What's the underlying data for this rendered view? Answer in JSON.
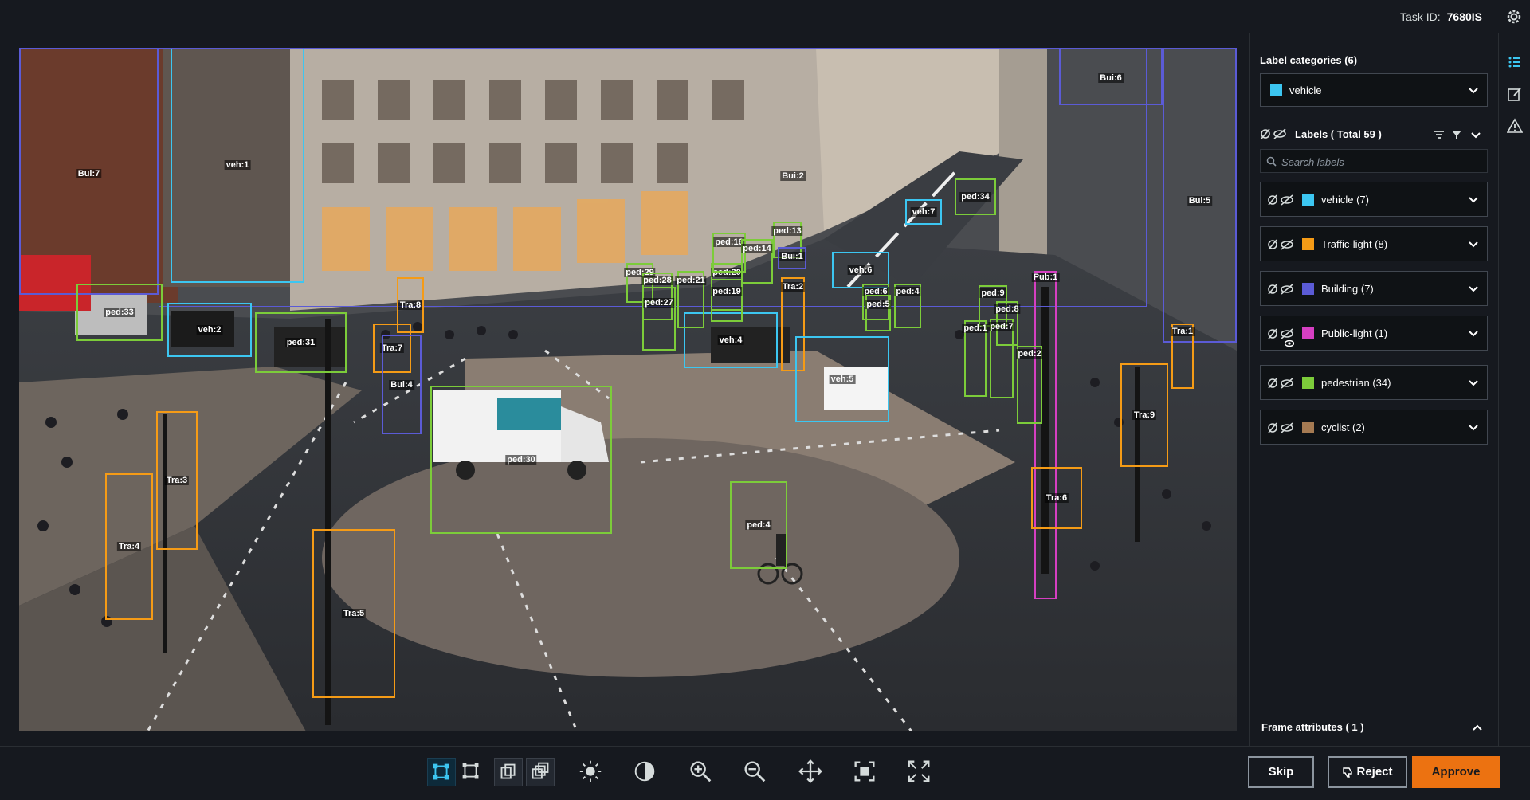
{
  "header": {
    "task_label": "Task ID:",
    "task_id": "7680IS"
  },
  "panel": {
    "categories_title": "Label categories (6)",
    "selected_category": {
      "label": "vehicle",
      "color": "#3cc6f1"
    },
    "labels_title": "Labels ( Total 59 )",
    "search_placeholder": "Search labels",
    "label_groups": [
      {
        "label": "vehicle (7)",
        "color": "#3cc6f1"
      },
      {
        "label": "Traffic-light (8)",
        "color": "#f59b16"
      },
      {
        "label": "Building (7)",
        "color": "#5b5bd6"
      },
      {
        "label": "Public-light (1)",
        "color": "#d63fc2"
      },
      {
        "label": "pedestrian (34)",
        "color": "#7ccc3a"
      },
      {
        "label": "cyclist (2)",
        "color": "#a57a52"
      }
    ],
    "frame_attributes": "Frame attributes ( 1 )"
  },
  "footer": {
    "skip": "Skip",
    "reject": "Reject",
    "approve": "Approve"
  },
  "annotations": [
    {
      "tag": "Bui:7",
      "color": "#5b5bd6"
    },
    {
      "tag": "veh:1",
      "color": "#3cc6f1"
    },
    {
      "tag": "Bui:2",
      "color": "#5b5bd6"
    },
    {
      "tag": "Bui:6",
      "color": "#5b5bd6"
    },
    {
      "tag": "Bui:5",
      "color": "#5b5bd6"
    },
    {
      "tag": "ped:33",
      "color": "#7ccc3a"
    },
    {
      "tag": "veh:2",
      "color": "#3cc6f1"
    },
    {
      "tag": "ped:31",
      "color": "#7ccc3a"
    },
    {
      "tag": "Tra:8",
      "color": "#f59b16"
    },
    {
      "tag": "Tra:7",
      "color": "#f59b16"
    },
    {
      "tag": "Bui:4",
      "color": "#5b5bd6"
    },
    {
      "tag": "ped:30",
      "color": "#7ccc3a"
    },
    {
      "tag": "veh:4",
      "color": "#3cc6f1"
    },
    {
      "tag": "Tra:2",
      "color": "#f59b16"
    },
    {
      "tag": "veh:5",
      "color": "#3cc6f1"
    },
    {
      "tag": "veh:6",
      "color": "#3cc6f1"
    },
    {
      "tag": "veh:7",
      "color": "#3cc6f1"
    },
    {
      "tag": "ped:34",
      "color": "#7ccc3a"
    },
    {
      "tag": "Pub:1",
      "color": "#d63fc2"
    },
    {
      "tag": "Tra:1",
      "color": "#f59b16"
    },
    {
      "tag": "Tra:9",
      "color": "#f59b16"
    },
    {
      "tag": "Tra:6",
      "color": "#f59b16"
    },
    {
      "tag": "Tra:3",
      "color": "#f59b16"
    },
    {
      "tag": "Tra:4",
      "color": "#f59b16"
    },
    {
      "tag": "Tra:5",
      "color": "#f59b16"
    },
    {
      "tag": "ped:4",
      "color": "#7ccc3a"
    },
    {
      "tag": "ped:29",
      "color": "#7ccc3a"
    },
    {
      "tag": "ped:28",
      "color": "#7ccc3a"
    },
    {
      "tag": "ped:27",
      "color": "#7ccc3a"
    },
    {
      "tag": "ped:21",
      "color": "#7ccc3a"
    },
    {
      "tag": "ped:20",
      "color": "#7ccc3a"
    },
    {
      "tag": "ped:19",
      "color": "#7ccc3a"
    },
    {
      "tag": "ped:16",
      "color": "#7ccc3a"
    },
    {
      "tag": "ped:14",
      "color": "#7ccc3a"
    },
    {
      "tag": "ped:13",
      "color": "#7ccc3a"
    },
    {
      "tag": "Bui:1",
      "color": "#5b5bd6"
    },
    {
      "tag": "ped:6",
      "color": "#7ccc3a"
    },
    {
      "tag": "ped:5",
      "color": "#7ccc3a"
    },
    {
      "tag": "ped:4",
      "color": "#7ccc3a"
    },
    {
      "tag": "ped:9",
      "color": "#7ccc3a"
    },
    {
      "tag": "ped:8",
      "color": "#7ccc3a"
    },
    {
      "tag": "ped:1",
      "color": "#7ccc3a"
    },
    {
      "tag": "ped:7",
      "color": "#7ccc3a"
    },
    {
      "tag": "ped:2",
      "color": "#7ccc3a"
    }
  ]
}
